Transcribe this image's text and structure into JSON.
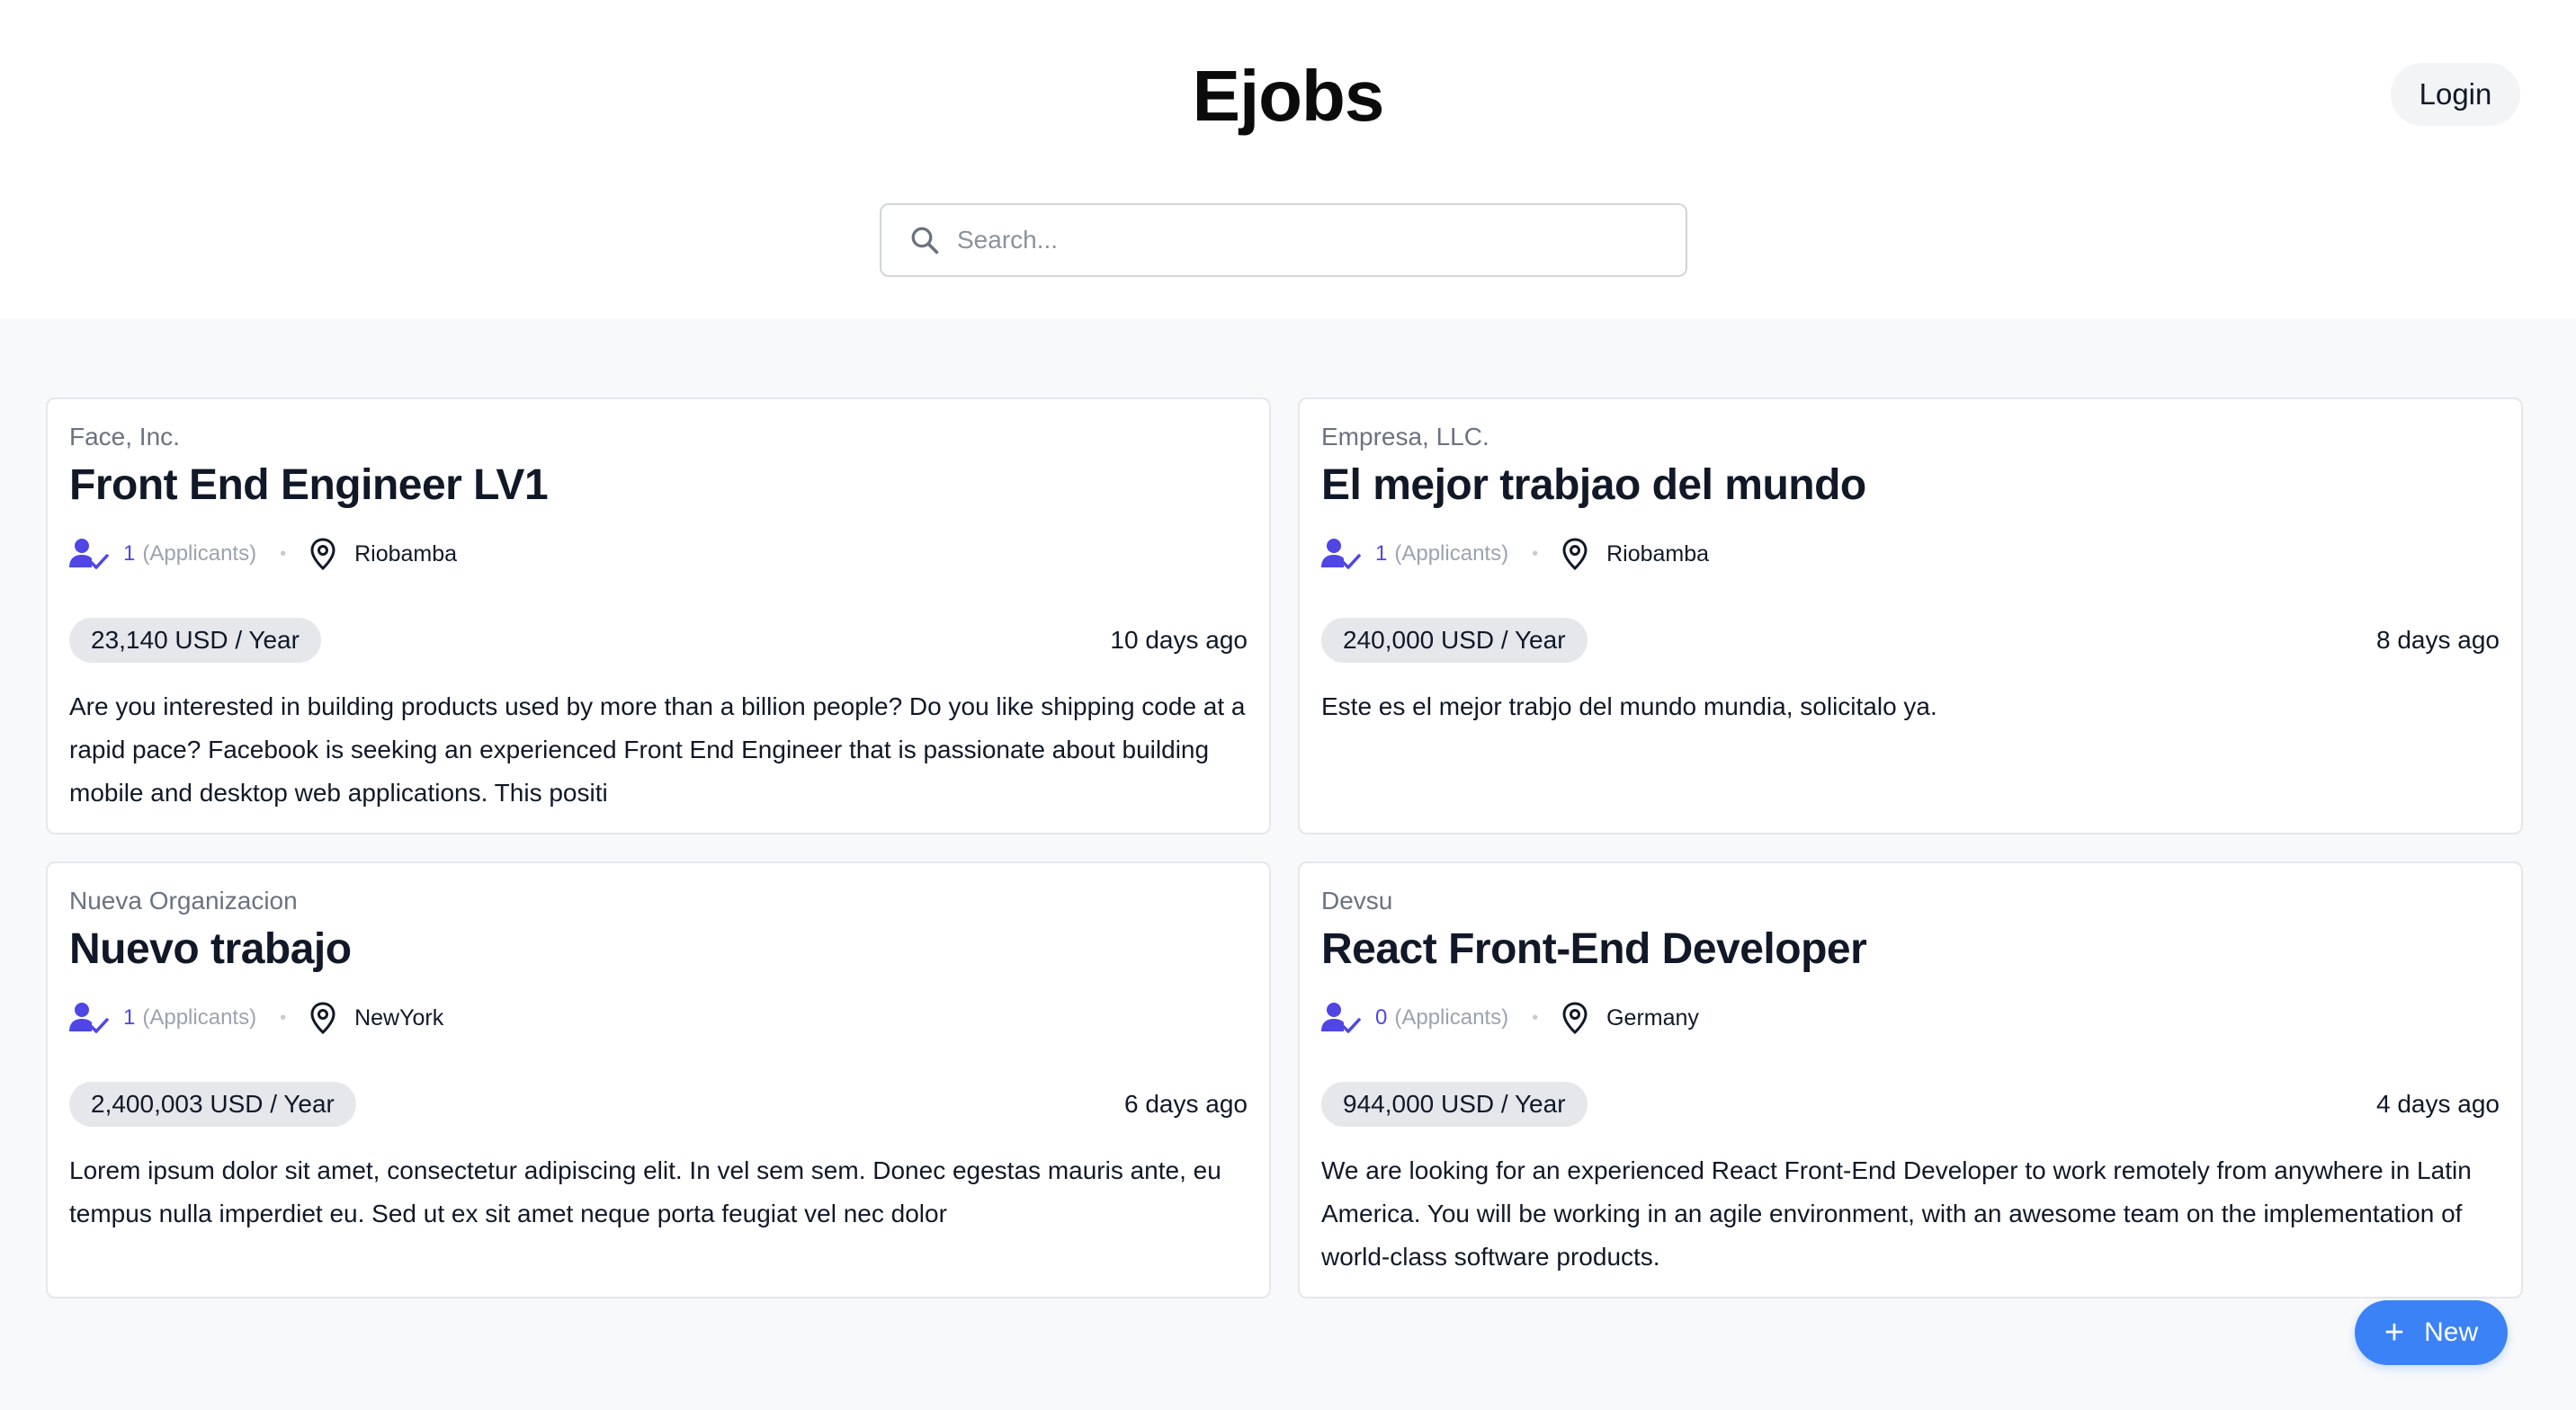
{
  "app": {
    "brand": "Ejobs",
    "login_label": "Login",
    "new_label": "New"
  },
  "search": {
    "placeholder": "Search...",
    "value": ""
  },
  "colors": {
    "accent": "#4f46e5",
    "primary_button": "#3b82f6",
    "badge_bg": "#e5e7eb"
  },
  "jobs": [
    {
      "company": "Face, Inc.",
      "title": "Front End Engineer LV1",
      "applicants": "1",
      "applicants_label": "(Applicants)",
      "location": "Riobamba",
      "salary": "23,140 USD / Year",
      "posted": "10 days ago",
      "description": "Are you interested in building products used by more than a billion people? Do you like shipping code at a rapid pace? Facebook is seeking an experienced Front End Engineer that is passionate about building mobile and desktop web applications. This positi"
    },
    {
      "company": "Empresa, LLC.",
      "title": "El mejor trabjao del mundo",
      "applicants": "1",
      "applicants_label": "(Applicants)",
      "location": "Riobamba",
      "salary": "240,000 USD / Year",
      "posted": "8 days ago",
      "description": "Este es el mejor trabjo del mundo mundia, solicitalo ya."
    },
    {
      "company": "Nueva Organizacion",
      "title": "Nuevo trabajo",
      "applicants": "1",
      "applicants_label": "(Applicants)",
      "location": "NewYork",
      "salary": "2,400,003 USD / Year",
      "posted": "6 days ago",
      "description": "Lorem ipsum dolor sit amet, consectetur adipiscing elit. In vel sem sem. Donec egestas mauris ante, eu tempus nulla imperdiet eu. Sed ut ex sit amet neque porta feugiat vel nec dolor"
    },
    {
      "company": "Devsu",
      "title": "React Front-End Developer",
      "applicants": "0",
      "applicants_label": "(Applicants)",
      "location": "Germany",
      "salary": "944,000 USD / Year",
      "posted": "4 days ago",
      "description": "We are looking for an experienced React Front-End Developer to work remotely from anywhere in Latin America. You will be working in an agile environment, with an awesome team on the implementation of world-class software products."
    }
  ],
  "icons": {
    "search": "search-icon",
    "applicants": "user-check-icon",
    "location": "map-pin-icon",
    "add": "plus-icon"
  }
}
